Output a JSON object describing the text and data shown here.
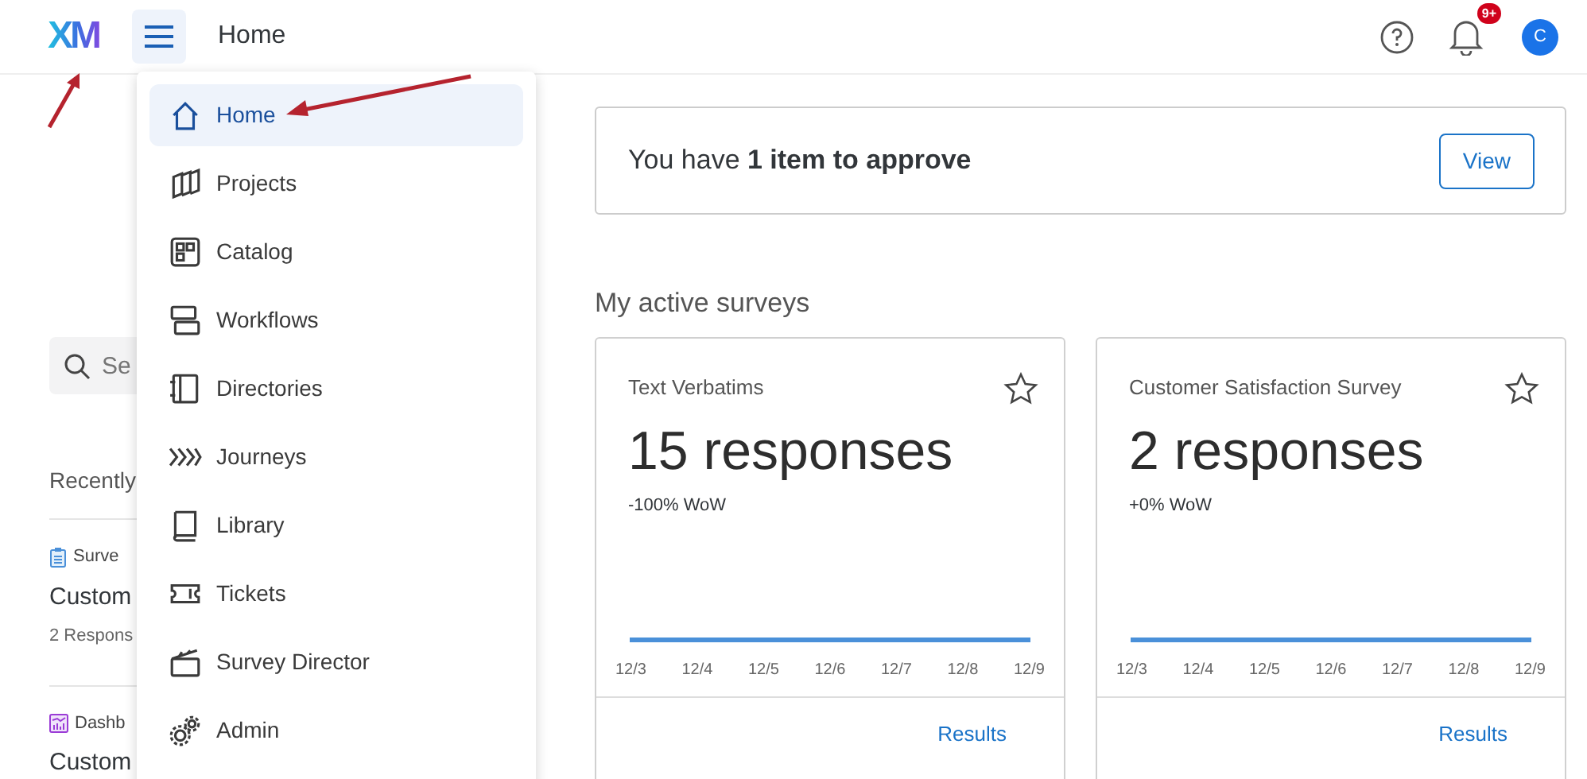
{
  "header": {
    "logo": "XM",
    "title": "Home",
    "notification_badge": "9+",
    "avatar": "C"
  },
  "sidebar": {
    "search_placeholder": "Se",
    "heading": "Recently",
    "items": [
      {
        "kind": "survey",
        "label": "Surve",
        "title": "Custom",
        "meta": "2 Respons"
      },
      {
        "kind": "dashboard",
        "label": "Dashb",
        "title": "Custom"
      }
    ]
  },
  "menu": {
    "items": [
      {
        "kind": "home",
        "label": "Home",
        "selected": true
      },
      {
        "kind": "projects",
        "label": "Projects",
        "selected": false
      },
      {
        "kind": "catalog",
        "label": "Catalog",
        "selected": false
      },
      {
        "kind": "workflows",
        "label": "Workflows",
        "selected": false
      },
      {
        "kind": "directories",
        "label": "Directories",
        "selected": false
      },
      {
        "kind": "journeys",
        "label": "Journeys",
        "selected": false
      },
      {
        "kind": "library",
        "label": "Library",
        "selected": false
      },
      {
        "kind": "tickets",
        "label": "Tickets",
        "selected": false
      },
      {
        "kind": "director",
        "label": "Survey Director",
        "selected": false
      },
      {
        "kind": "admin",
        "label": "Admin",
        "selected": false
      }
    ]
  },
  "approval": {
    "text": "You have **1 item to approve**",
    "button": "View"
  },
  "section_title": "My active surveys",
  "surveys": [
    {
      "name": "Text Verbatims",
      "starred": false,
      "count": "15 responses",
      "change": "-100% WoW",
      "x_labels": [
        "12/3",
        "12/4",
        "12/5",
        "12/6",
        "12/7",
        "12/8",
        "12/9"
      ],
      "link": "Results"
    },
    {
      "name": "Customer Satisfaction Survey",
      "starred": false,
      "count": "2 responses",
      "change": "+0% WoW",
      "x_labels": [
        "12/3",
        "12/4",
        "12/5",
        "12/6",
        "12/7",
        "12/8",
        "12/9"
      ],
      "link": "Results"
    }
  ]
}
